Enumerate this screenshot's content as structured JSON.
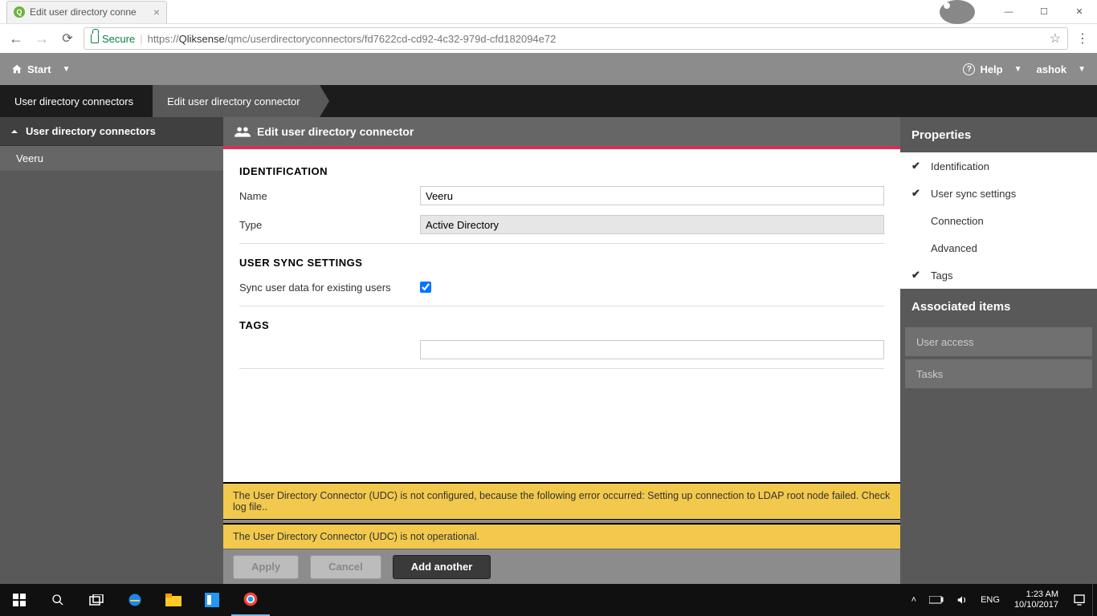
{
  "browser": {
    "tab_title": "Edit user directory conne",
    "secure_label": "Secure",
    "url_host": "Qliksense",
    "url_path": "/qmc/userdirectoryconnectors/fd7622cd-cd92-4c32-979d-cfd182094e72",
    "url_prefix": "https://"
  },
  "appbar": {
    "start": "Start",
    "help": "Help",
    "user": "ashok"
  },
  "breadcrumb": {
    "level1": "User directory connectors",
    "level2": "Edit user directory connector"
  },
  "left_panel": {
    "header": "User directory connectors",
    "items": [
      "Veeru"
    ]
  },
  "center": {
    "title": "Edit user directory connector",
    "sections": {
      "identification": {
        "heading": "IDENTIFICATION",
        "name_label": "Name",
        "name_value": "Veeru",
        "type_label": "Type",
        "type_value": "Active Directory"
      },
      "sync": {
        "heading": "USER SYNC SETTINGS",
        "sync_label": "Sync user data for existing users",
        "sync_checked": true
      },
      "tags": {
        "heading": "TAGS",
        "tags_value": ""
      }
    },
    "alerts": [
      "The User Directory Connector (UDC) is not configured, because the following error occurred: Setting up connection to LDAP root node failed. Check log file..",
      "The User Directory Connector (UDC) is not operational."
    ],
    "buttons": {
      "apply": "Apply",
      "cancel": "Cancel",
      "add_another": "Add another"
    }
  },
  "right_panel": {
    "properties_heading": "Properties",
    "properties": [
      {
        "label": "Identification",
        "checked": true
      },
      {
        "label": "User sync settings",
        "checked": true
      },
      {
        "label": "Connection",
        "checked": false
      },
      {
        "label": "Advanced",
        "checked": false
      },
      {
        "label": "Tags",
        "checked": true
      }
    ],
    "associated_heading": "Associated items",
    "associated": [
      "User access",
      "Tasks"
    ]
  },
  "taskbar": {
    "lang": "ENG",
    "time": "1:23 AM",
    "date": "10/10/2017"
  }
}
